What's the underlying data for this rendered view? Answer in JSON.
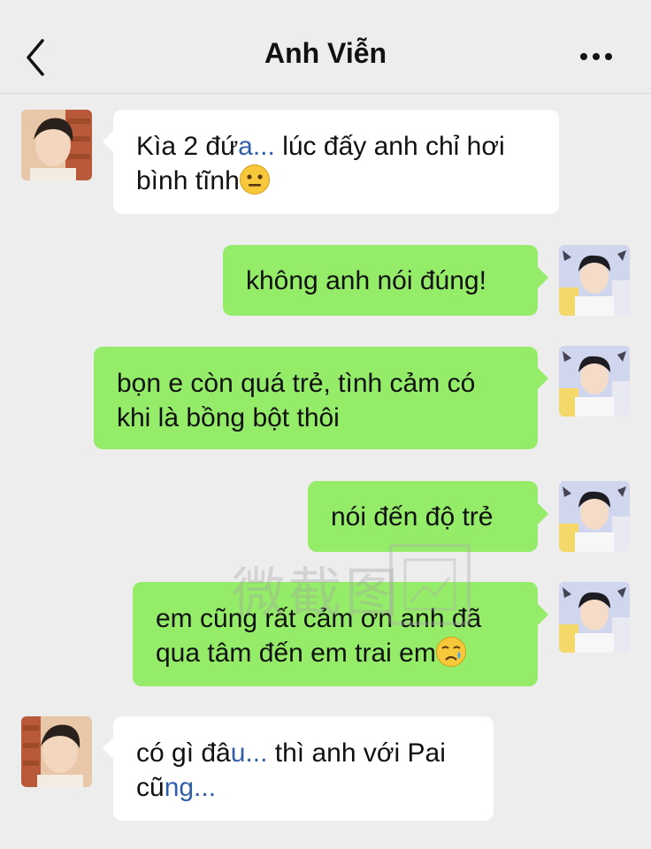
{
  "header": {
    "title": "Anh Viễn"
  },
  "watermark": {
    "text": "微截图"
  },
  "messages": [
    {
      "side": "left",
      "pre": "Kìa 2 đứ",
      "hl": "a...",
      "post": " lúc đấy anh chỉ hơi bình tĩnh",
      "emoji": "neutral-face"
    },
    {
      "side": "right",
      "text": "không anh nói đúng!"
    },
    {
      "side": "right",
      "text": "bọn e còn quá trẻ, tình cảm có khi là bồng bột thôi"
    },
    {
      "side": "right",
      "text": "nói đến độ trẻ"
    },
    {
      "side": "right",
      "text": "em cũng rất cảm ơn anh đã qua tâm đến em trai em",
      "emoji": "crying-face"
    },
    {
      "side": "left",
      "pre": "có gì đâ",
      "hl": "u...",
      "post": " thì anh với Pai cũ",
      "hl2": "ng..."
    }
  ],
  "colors": {
    "background": "#ededed",
    "my_bubble": "#95ec69",
    "their_bubble": "#ffffff"
  }
}
